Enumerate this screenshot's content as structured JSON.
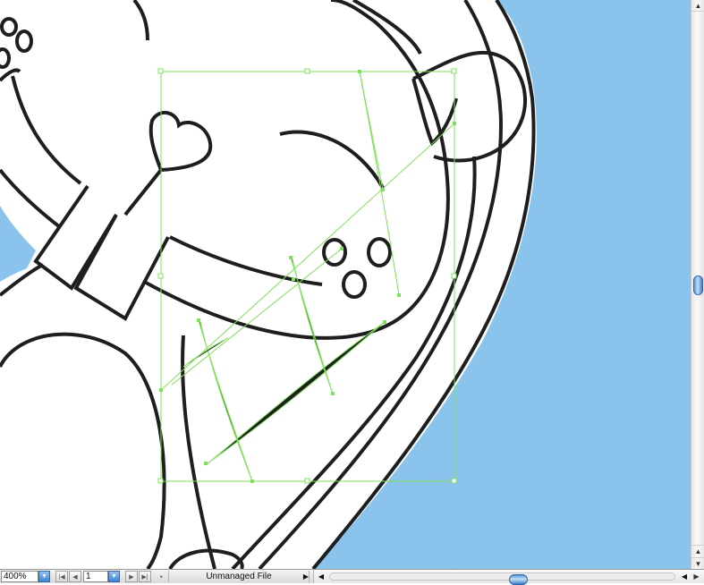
{
  "canvas": {
    "background_color": "#8AC3EB",
    "artwork_color": "#FFFFFF",
    "stroke_color": "#1E1E1E",
    "selection_color": "#7FE05A"
  },
  "statusbar": {
    "zoom_value": "400%",
    "page_value": "1",
    "status_text": "Unmanaged File",
    "icons": {
      "dropdown": "triangle-down-icon",
      "first": "first-page-icon",
      "prev": "previous-page-icon",
      "next": "next-page-icon",
      "last": "last-page-icon",
      "status": "status-circle-icon",
      "menu": "triangle-right-icon"
    }
  },
  "scrollbar": {
    "accent_color": "#4A8AD4"
  }
}
